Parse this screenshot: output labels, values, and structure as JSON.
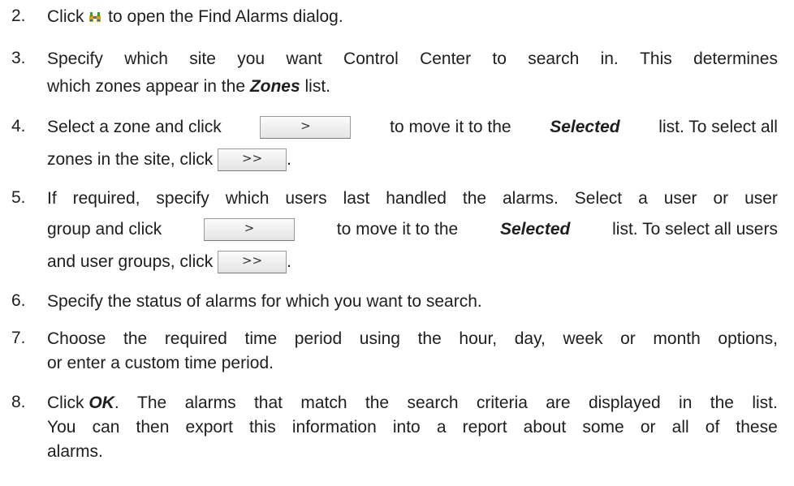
{
  "steps": [
    {
      "num": "2.",
      "before": "Click",
      "icon": "binoculars-icon",
      "after": " to open the Find Alarms dialog."
    },
    {
      "num": "3.",
      "line1": [
        "Specify",
        "which",
        "site",
        "you",
        "want",
        "Control",
        "Center",
        "to",
        "search",
        "in.",
        "This",
        "determines"
      ],
      "line2_before": "which zones appear in the ",
      "line2_em": "Zones",
      "line2_after": " list."
    },
    {
      "num": "4.",
      "seg1": "Select a zone and click",
      "btn1": ">",
      "seg2": "to move it to the",
      "em": "Selected",
      "seg3": "list. To select all",
      "line2_before": "zones in the site, click ",
      "btn2": ">>",
      "line2_after": "."
    },
    {
      "num": "5.",
      "line1": [
        "If",
        "required,",
        "specify",
        "which",
        "users",
        "last",
        "handled",
        "the",
        "alarms.",
        "Select",
        "a",
        "user",
        "or",
        "user"
      ],
      "seg1": "group and click",
      "btn1": ">",
      "seg2": "to move it to the",
      "em": "Selected",
      "seg3": "list. To select all users",
      "line3_before": "and user groups, click ",
      "btn2": ">>",
      "line3_after": "."
    },
    {
      "num": "6.",
      "text": "Specify the status of alarms for which you want to search."
    },
    {
      "num": "7.",
      "line1": [
        "Choose",
        "the",
        "required",
        "time",
        "period",
        "using",
        "the",
        "hour,",
        "day,",
        "week",
        "or",
        "month",
        "options,"
      ],
      "line2": "or enter a custom time period."
    },
    {
      "num": "8.",
      "before": "Click ",
      "em": "OK",
      "line1_after": [
        "The",
        "alarms",
        "that",
        "match",
        "the",
        "search",
        "criteria",
        "are",
        "displayed",
        "in",
        "the",
        "list."
      ],
      "line2": [
        "You",
        "can",
        "then",
        "export",
        "this",
        "information",
        "into",
        "a",
        "report",
        "about",
        "some",
        "or",
        "all",
        "of",
        "these"
      ],
      "line3": "alarms."
    }
  ]
}
